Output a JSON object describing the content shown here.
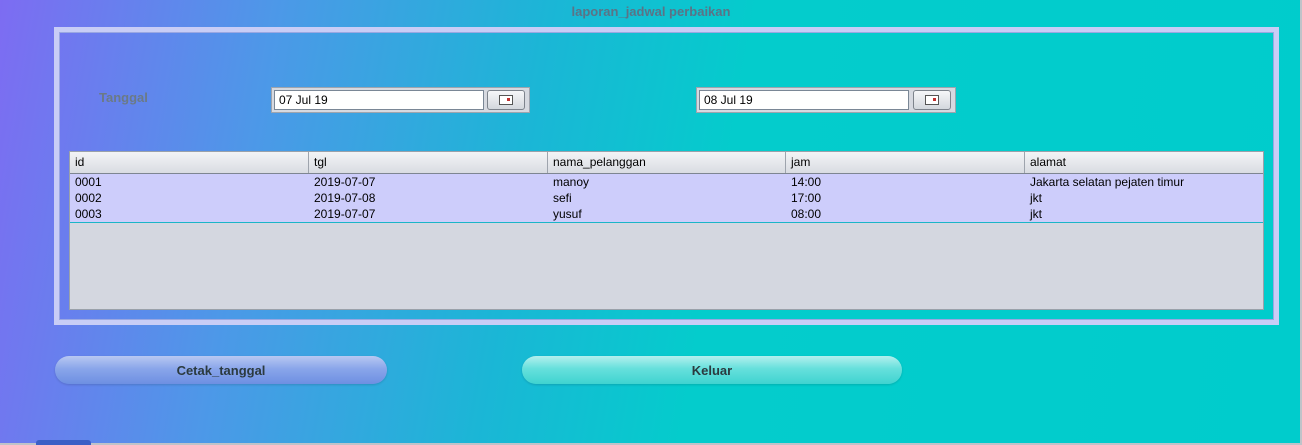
{
  "window": {
    "title": "laporan_jadwal perbaikan"
  },
  "filter": {
    "label": "Tanggal",
    "date_from": "07 Jul 19",
    "date_to": "08 Jul 19"
  },
  "table": {
    "columns": [
      "id",
      "tgl",
      "nama_pelanggan",
      "jam",
      "alamat"
    ],
    "rows": [
      [
        "0001",
        "2019-07-07",
        "manoy",
        "14:00",
        "Jakarta selatan pejaten timur"
      ],
      [
        "0002",
        "2019-07-08",
        "sefi",
        "17:00",
        "jkt"
      ],
      [
        "0003",
        "2019-07-07",
        "yusuf",
        "08:00",
        "jkt"
      ]
    ]
  },
  "actions": {
    "print_label": "Cetak_tanggal",
    "exit_label": "Keluar"
  },
  "colors": {
    "row_background": "#cdcdfb",
    "panel_border": "#c8cdf6",
    "background_accent": "#00cccc"
  }
}
